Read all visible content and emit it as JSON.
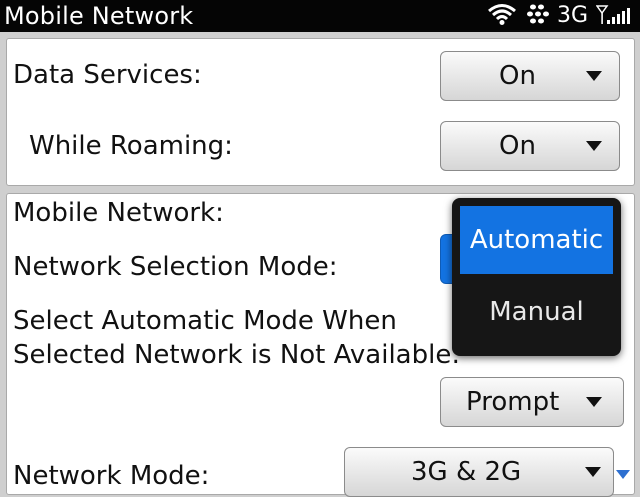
{
  "status_bar": {
    "title": "Mobile Network",
    "network_type": "3G",
    "icons": [
      "wifi-icon",
      "bluetooth-icon",
      "signal-strength-icon"
    ]
  },
  "data_section": {
    "data_services": {
      "label": "Data Services:",
      "value": "On"
    },
    "while_roaming": {
      "label": "While Roaming:",
      "value": "On"
    }
  },
  "network_section": {
    "mobile_network_label": "Mobile Network:",
    "selection_mode_label": "Network Selection Mode:",
    "auto_mode_label_line1": "Select Automatic Mode When",
    "auto_mode_label_line2": "Selected Network is Not Available:",
    "auto_mode_value": "Prompt",
    "network_mode_label": "Network Mode:",
    "network_mode_value": "3G & 2G"
  },
  "selection_popup": {
    "options": [
      "Automatic",
      "Manual"
    ],
    "selected": "Automatic"
  },
  "colors": {
    "status_bar_bg": "#050505",
    "popup_bg": "#161616",
    "highlight": "#1373e2",
    "page_bg": "#cfcfcf"
  }
}
